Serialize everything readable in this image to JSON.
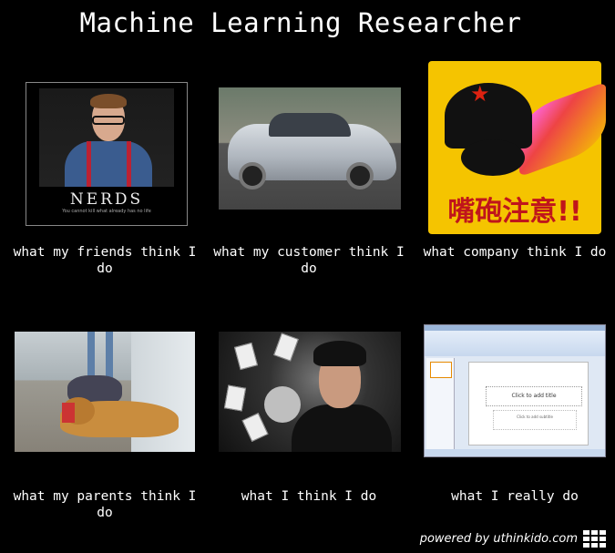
{
  "title": "Machine Learning Researcher",
  "panels": [
    {
      "caption": "what my friends think I do",
      "poster_title": "NERDS",
      "poster_subtitle": "You cannot kill what already has no life"
    },
    {
      "caption": "what my customer think I do"
    },
    {
      "caption": "what company think I do",
      "sign_text": "嘴砲注意!!"
    },
    {
      "caption": "what my parents think I do"
    },
    {
      "caption": "what I think I do"
    },
    {
      "caption": "what I really do",
      "slide_title_placeholder": "Click to add title",
      "slide_subtitle_placeholder": "Click to add subtitle"
    }
  ],
  "footer": {
    "text": "powered by uthinkido.com",
    "icon": "grid-icon"
  }
}
